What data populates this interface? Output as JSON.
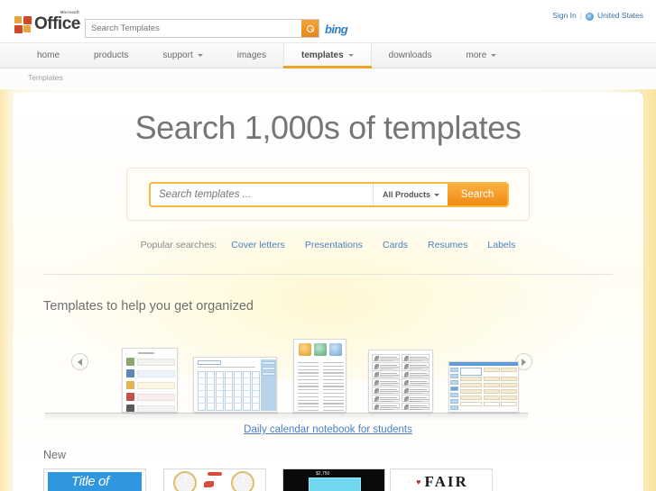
{
  "header": {
    "logo_text": "Office",
    "logo_superscript": "Microsoft",
    "search_placeholder": "Search Templates",
    "search_icon": "magnifier-icon",
    "bing_label": "bing",
    "sign_in": "Sign In",
    "separator": "|",
    "region": "United States",
    "region_icon": "globe-icon"
  },
  "nav": {
    "items": [
      {
        "label": "home",
        "has_caret": false,
        "active": false
      },
      {
        "label": "products",
        "has_caret": false,
        "active": false
      },
      {
        "label": "support",
        "has_caret": true,
        "active": false
      },
      {
        "label": "images",
        "has_caret": false,
        "active": false
      },
      {
        "label": "templates",
        "has_caret": true,
        "active": true
      },
      {
        "label": "downloads",
        "has_caret": false,
        "active": false
      },
      {
        "label": "more",
        "has_caret": true,
        "active": false
      }
    ]
  },
  "breadcrumb": {
    "current": "Templates"
  },
  "hero": {
    "title": "Search 1,000s of templates",
    "search_placeholder": "Search templates ...",
    "search_value": "",
    "product_filter": "All Products",
    "search_button": "Search"
  },
  "popular": {
    "label": "Popular searches:",
    "links": [
      "Cover letters",
      "Presentations",
      "Cards",
      "Resumes",
      "Labels"
    ]
  },
  "organized": {
    "heading": "Templates to help you get organized",
    "prev_arrow": "previous-arrow-icon",
    "next_arrow": "next-arrow-icon",
    "caption_link": "Daily calendar notebook for students"
  },
  "new_section": {
    "heading": "New",
    "tiles": [
      {
        "name": "title-of-template",
        "text": "Title of"
      },
      {
        "name": "bicycle-template",
        "text": ""
      },
      {
        "name": "price-card-template",
        "text": "$2,750"
      },
      {
        "name": "fair-template",
        "text": "FAIR",
        "heart": "♥"
      }
    ]
  },
  "colors": {
    "accent_orange": "#f0a32a",
    "link_blue": "#4a7fc4",
    "bing_blue": "#2f7dc0",
    "page_cream": "#fffdf6",
    "edge_yellow": "#f3d260"
  }
}
